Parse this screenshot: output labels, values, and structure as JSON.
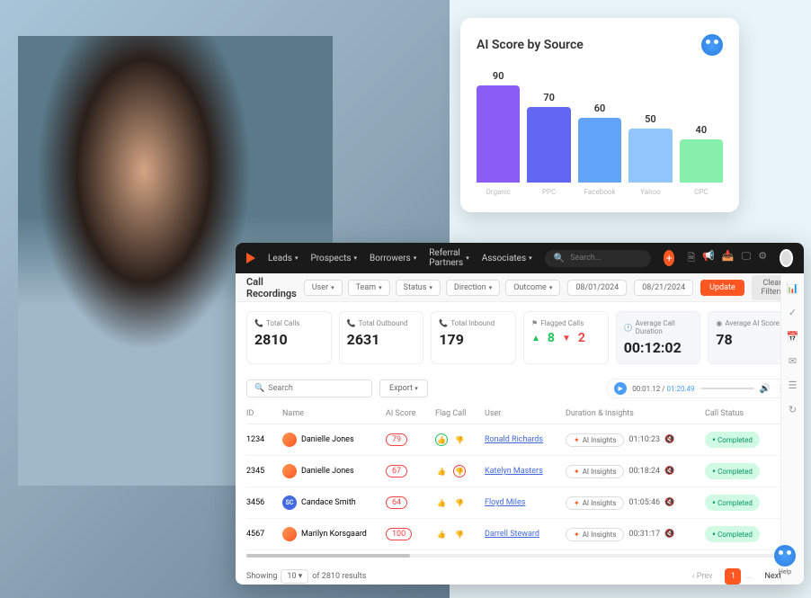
{
  "chart_data": {
    "type": "bar",
    "title": "AI Score by Source",
    "categories": [
      "Organic",
      "PPC",
      "Facebook",
      "Yahoo",
      "CPC"
    ],
    "values": [
      90,
      70,
      60,
      50,
      40
    ],
    "colors": [
      "#8b5cf6",
      "#6366f1",
      "#60a5fa",
      "#93c5fd",
      "#86efac"
    ],
    "ylim": [
      0,
      100
    ]
  },
  "nav": {
    "items": [
      "Leads",
      "Prospects",
      "Borrowers",
      "Referral Partners",
      "Associates"
    ]
  },
  "search": {
    "placeholder": "Search..."
  },
  "page": {
    "title": "Call Recordings"
  },
  "filters": {
    "items": [
      "User",
      "Team",
      "Status",
      "Direction",
      "Outcome"
    ],
    "date_from": "08/01/2024",
    "date_to": "08/21/2024",
    "update": "Update",
    "clear": "Clear Filters"
  },
  "stats": {
    "total_calls": {
      "label": "Total Calls",
      "value": "2810"
    },
    "outbound": {
      "label": "Total Outbound",
      "value": "2631"
    },
    "inbound": {
      "label": "Total Inbound",
      "value": "179"
    },
    "flagged": {
      "label": "Flagged Calls",
      "up": "8",
      "down": "2"
    },
    "avg_duration": {
      "label": "Average Call Duration",
      "value": "00:12:02"
    },
    "avg_score": {
      "label": "Average AI Score",
      "value": "78"
    }
  },
  "table_search": {
    "placeholder": "Search"
  },
  "export": "Export",
  "audio": {
    "current": "00:01.12",
    "total": "01:20.49"
  },
  "columns": {
    "id": "ID",
    "name": "Name",
    "score": "AI Score",
    "flag": "Flag Call",
    "user": "User",
    "duration": "Duration & Insights",
    "status": "Call Status"
  },
  "ai_insights_label": "AI Insights",
  "completed_label": "Completed",
  "rows": [
    {
      "id": "1234",
      "name": "Danielle Jones",
      "score": "79",
      "user": "Ronald Richards",
      "duration": "01:10:23",
      "av": "org",
      "flag_g_outline": true,
      "flag_r_outline": false
    },
    {
      "id": "2345",
      "name": "Danielle Jones",
      "score": "67",
      "user": "Katelyn Masters",
      "duration": "00:18:24",
      "av": "org",
      "flag_g_outline": false,
      "flag_r_outline": true
    },
    {
      "id": "3456",
      "name": "Candace Smith",
      "score": "64",
      "user": "Floyd Miles",
      "duration": "01:05:46",
      "av": "blu",
      "initials": "SC",
      "flag_g_outline": false,
      "flag_r_outline": false
    },
    {
      "id": "4567",
      "name": "Marilyn Korsgaard",
      "score": "100",
      "user": "Darrell Steward",
      "duration": "00:31:17",
      "av": "org",
      "flag_g_outline": false,
      "flag_r_outline": false
    }
  ],
  "pagination": {
    "showing": "Showing",
    "per_page": "10",
    "of": "of 2810 results",
    "prev": "Prev",
    "page": "1",
    "next": "Next"
  },
  "help": "Help"
}
